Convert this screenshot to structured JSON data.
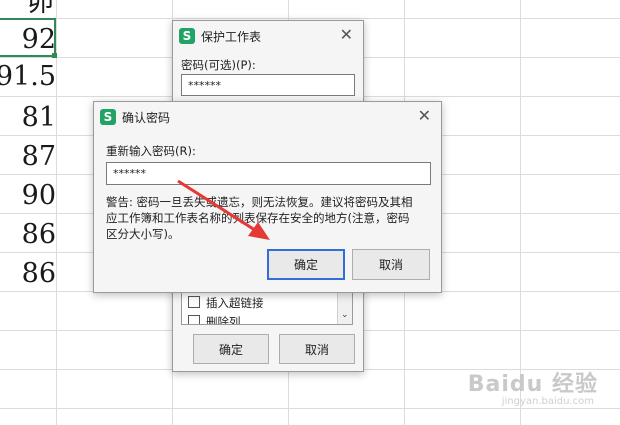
{
  "sheet": {
    "values": [
      "卯",
      "92",
      "91.5",
      "81",
      "87",
      "90",
      "86",
      "86"
    ]
  },
  "protect_dialog": {
    "title": "保护工作表",
    "password_label": "密码(可选)(P):",
    "password_value": "******",
    "checkbox_label_1": "插入超链接",
    "checkbox_label_2": "删除列",
    "ok_label": "确定",
    "cancel_label": "取消"
  },
  "confirm_dialog": {
    "title": "确认密码",
    "reenter_label": "重新输入密码(R):",
    "password_value": "******",
    "warning_line1": "警告: 密码一旦丢失或遗忘，则无法恢复。建议将密码及其相",
    "warning_line2": "应工作簿和工作表名称的列表保存在安全的地方(注意，密码",
    "warning_line3": "区分大小写)。",
    "ok_label": "确定",
    "cancel_label": "取消"
  },
  "watermark": {
    "brand": "Baidu 经验",
    "url": "jingyan.baidu.com"
  },
  "colors": {
    "accent_green": "#2e8b57",
    "focus_blue": "#2f6fd6",
    "arrow_red": "#e53935"
  }
}
